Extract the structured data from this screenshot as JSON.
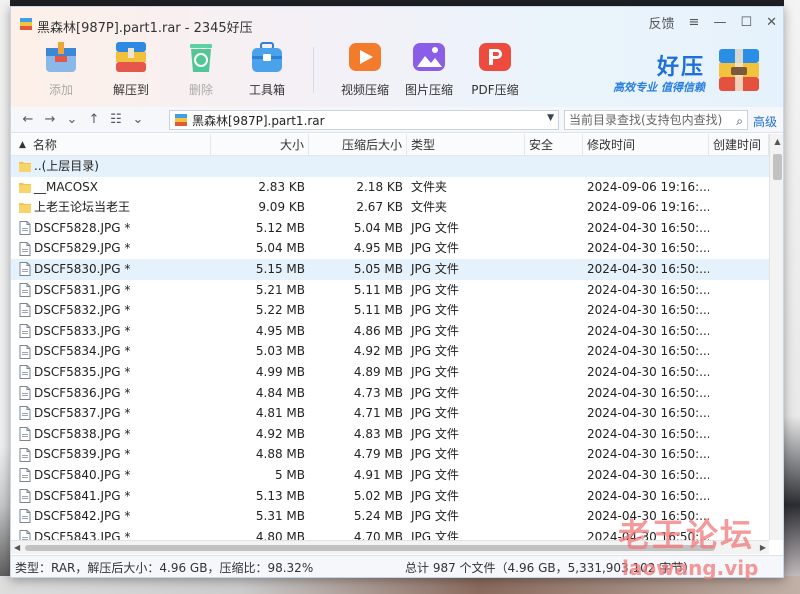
{
  "window": {
    "title": "黑森林[987P].part1.rar - 2345好压",
    "controls": {
      "feedback": "反馈",
      "menu": "≡",
      "minimize": "—",
      "maximize": "☐",
      "close": "✕"
    }
  },
  "toolbar": {
    "add": "添加",
    "extract_to": "解压到",
    "delete": "删除",
    "toolbox": "工具箱",
    "video_compress": "视频压缩",
    "image_compress": "图片压缩",
    "pdf_compress": "PDF压缩"
  },
  "brand": {
    "name": "好压",
    "slogan": "高效专业 值得信赖"
  },
  "navbar": {
    "path": "黑森林[987P].part1.rar",
    "search_placeholder": "当前目录查找(支持包内查找)",
    "advanced": "高级"
  },
  "columns": {
    "name": "名称",
    "size": "大小",
    "compressed": "压缩后大小",
    "type": "类型",
    "security": "安全",
    "modified": "修改时间",
    "created": "创建时间"
  },
  "files": [
    {
      "name": "..(上层目录)",
      "size": "",
      "compressed": "",
      "type": "",
      "modified": "",
      "kind": "folder"
    },
    {
      "name": "__MACOSX",
      "size": "2.83 KB",
      "compressed": "2.18 KB",
      "type": "文件夹",
      "modified": "2024-09-06 19:16:...",
      "kind": "folder"
    },
    {
      "name": "上老王论坛当老王",
      "size": "9.09 KB",
      "compressed": "2.67 KB",
      "type": "文件夹",
      "modified": "2024-09-06 19:16:...",
      "kind": "folder"
    },
    {
      "name": "DSCF5828.JPG *",
      "size": "5.12 MB",
      "compressed": "5.04 MB",
      "type": "JPG 文件",
      "modified": "2024-04-30 16:50:...",
      "kind": "file"
    },
    {
      "name": "DSCF5829.JPG *",
      "size": "5.04 MB",
      "compressed": "4.95 MB",
      "type": "JPG 文件",
      "modified": "2024-04-30 16:50:...",
      "kind": "file"
    },
    {
      "name": "DSCF5830.JPG *",
      "size": "5.15 MB",
      "compressed": "5.05 MB",
      "type": "JPG 文件",
      "modified": "2024-04-30 16:50:...",
      "kind": "file"
    },
    {
      "name": "DSCF5831.JPG *",
      "size": "5.21 MB",
      "compressed": "5.11 MB",
      "type": "JPG 文件",
      "modified": "2024-04-30 16:50:...",
      "kind": "file"
    },
    {
      "name": "DSCF5832.JPG *",
      "size": "5.22 MB",
      "compressed": "5.11 MB",
      "type": "JPG 文件",
      "modified": "2024-04-30 16:50:...",
      "kind": "file"
    },
    {
      "name": "DSCF5833.JPG *",
      "size": "4.95 MB",
      "compressed": "4.86 MB",
      "type": "JPG 文件",
      "modified": "2024-04-30 16:50:...",
      "kind": "file"
    },
    {
      "name": "DSCF5834.JPG *",
      "size": "5.03 MB",
      "compressed": "4.92 MB",
      "type": "JPG 文件",
      "modified": "2024-04-30 16:50:...",
      "kind": "file"
    },
    {
      "name": "DSCF5835.JPG *",
      "size": "4.99 MB",
      "compressed": "4.89 MB",
      "type": "JPG 文件",
      "modified": "2024-04-30 16:50:...",
      "kind": "file"
    },
    {
      "name": "DSCF5836.JPG *",
      "size": "4.84 MB",
      "compressed": "4.73 MB",
      "type": "JPG 文件",
      "modified": "2024-04-30 16:50:...",
      "kind": "file"
    },
    {
      "name": "DSCF5837.JPG *",
      "size": "4.81 MB",
      "compressed": "4.71 MB",
      "type": "JPG 文件",
      "modified": "2024-04-30 16:50:...",
      "kind": "file"
    },
    {
      "name": "DSCF5838.JPG *",
      "size": "4.92 MB",
      "compressed": "4.83 MB",
      "type": "JPG 文件",
      "modified": "2024-04-30 16:50:...",
      "kind": "file"
    },
    {
      "name": "DSCF5839.JPG *",
      "size": "4.88 MB",
      "compressed": "4.79 MB",
      "type": "JPG 文件",
      "modified": "2024-04-30 16:50:...",
      "kind": "file"
    },
    {
      "name": "DSCF5840.JPG *",
      "size": "5 MB",
      "compressed": "4.91 MB",
      "type": "JPG 文件",
      "modified": "2024-04-30 16:50:...",
      "kind": "file"
    },
    {
      "name": "DSCF5841.JPG *",
      "size": "5.13 MB",
      "compressed": "5.02 MB",
      "type": "JPG 文件",
      "modified": "2024-04-30 16:50:...",
      "kind": "file"
    },
    {
      "name": "DSCF5842.JPG *",
      "size": "5.31 MB",
      "compressed": "5.24 MB",
      "type": "JPG 文件",
      "modified": "2024-04-30 16:50:...",
      "kind": "file"
    },
    {
      "name": "DSCF5843.JPG *",
      "size": "4.80 MB",
      "compressed": "4.70 MB",
      "type": "JPG 文件",
      "modified": "2024-04-30 16:50:...",
      "kind": "file"
    }
  ],
  "selected_index": 5,
  "status": {
    "left": "类型：RAR，解压后大小：4.96 GB，压缩比：98.32%",
    "right": "总计 987 个文件（4.96 GB，5,331,903,102 字节）"
  },
  "watermark": {
    "line1": "老王论坛",
    "line2": "laowang.vip"
  },
  "colors": {
    "accent": "#1e6fd9",
    "selection": "#e5f1fb",
    "folder": "#f6c445"
  }
}
